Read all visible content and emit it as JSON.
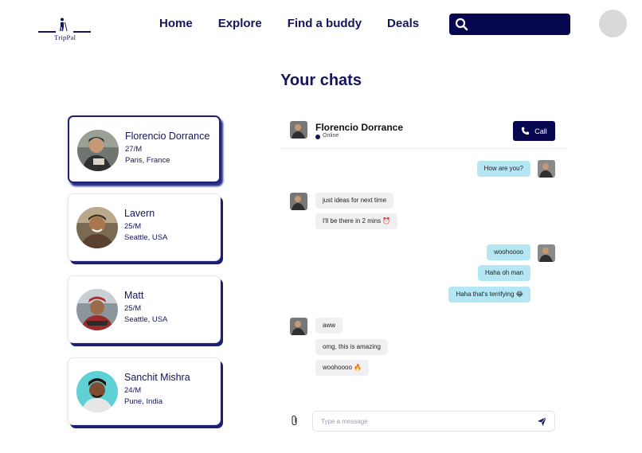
{
  "brand": {
    "name": "TripPal"
  },
  "nav": {
    "items": [
      {
        "label": "Home"
      },
      {
        "label": "Explore"
      },
      {
        "label": "Find a buddy"
      },
      {
        "label": "Deals"
      }
    ]
  },
  "search": {
    "placeholder": "",
    "value": "",
    "icon": "search-icon"
  },
  "page": {
    "title": "Your chats"
  },
  "contacts": [
    {
      "name": "Florencio Dorrance",
      "age": "27/M",
      "location": "Paris, France",
      "active": true
    },
    {
      "name": "Lavern",
      "age": "25/M",
      "location": "Seattle, USA",
      "active": false
    },
    {
      "name": "Matt",
      "age": "25/M",
      "location": "Seattle, USA",
      "active": false
    },
    {
      "name": "Sanchit Mishra",
      "age": "24/M",
      "location": "Pune, India",
      "active": false
    }
  ],
  "chat": {
    "name": "Florencio Dorrance",
    "status": "Online",
    "call_label": "Call",
    "messages": [
      {
        "text": "How are you?",
        "dir": "out"
      },
      {
        "text": "just ideas for next time",
        "dir": "in"
      },
      {
        "text": "I'll be there in 2 mins ⏰",
        "dir": "in"
      },
      {
        "text": "woohoooo",
        "dir": "out"
      },
      {
        "text": "Haha oh man",
        "dir": "out"
      },
      {
        "text": "Haha that's terrifying 😂",
        "dir": "out"
      },
      {
        "text": "aww",
        "dir": "in"
      },
      {
        "text": "omg, this is amazing",
        "dir": "in"
      },
      {
        "text": "woohoooo 🔥",
        "dir": "in"
      }
    ],
    "composer_placeholder": "Type a message"
  },
  "colors": {
    "navy": "#07074f",
    "text": "#14155c",
    "bubble_out": "#b4e6f4",
    "bubble_in": "#f0f0f2",
    "online": "#14155c"
  }
}
